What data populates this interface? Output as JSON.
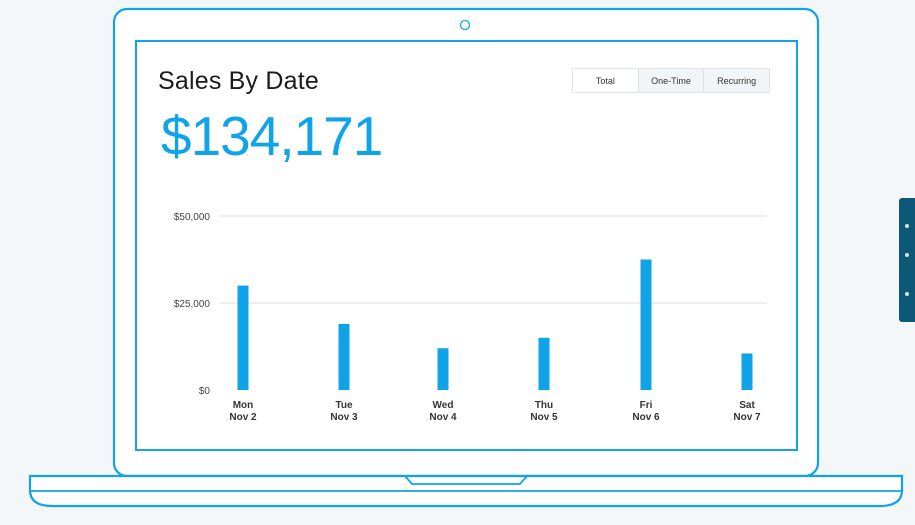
{
  "widget": {
    "title": "Sales By Date",
    "total": "$134,171"
  },
  "toggle": {
    "options": [
      "Total",
      "One-Time",
      "Recurring"
    ],
    "selected": "Total"
  },
  "colors": {
    "accent": "#11a3e8",
    "grid": "#d9dee2",
    "side_tab": "#0d5877"
  },
  "chart_data": {
    "type": "bar",
    "categories": [
      "Mon",
      "Tue",
      "Wed",
      "Thu",
      "Fri",
      "Sat"
    ],
    "category_sublabels": [
      "Nov 2",
      "Nov 3",
      "Nov 4",
      "Nov 5",
      "Nov 6",
      "Nov 7"
    ],
    "values": [
      30000,
      19000,
      12000,
      15000,
      37500,
      10500
    ],
    "ylim": [
      0,
      50000
    ],
    "yticks": [
      0,
      25000,
      50000
    ],
    "ytick_labels": [
      "$0",
      "$25,000",
      "$50,000"
    ],
    "grid": true
  }
}
